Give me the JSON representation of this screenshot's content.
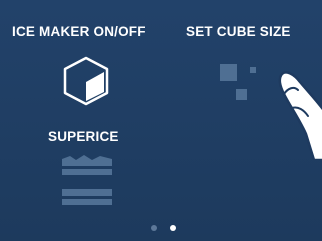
{
  "labels": {
    "ice_maker": "ICE MAKER ON/OFF",
    "set_cube_size": "SET CUBE SIZE",
    "superice": "SUPERICE"
  },
  "pagination": {
    "total": 2,
    "active": 2
  },
  "colors": {
    "background": "#1f3c60",
    "text": "#ffffff",
    "icon_muted": "#4f6f93",
    "dot_inactive": "#5d7899",
    "dot_active": "#ffffff"
  },
  "icons": [
    "cube-icon",
    "cube-size-icon",
    "superice-icon",
    "finger-touch-icon"
  ]
}
